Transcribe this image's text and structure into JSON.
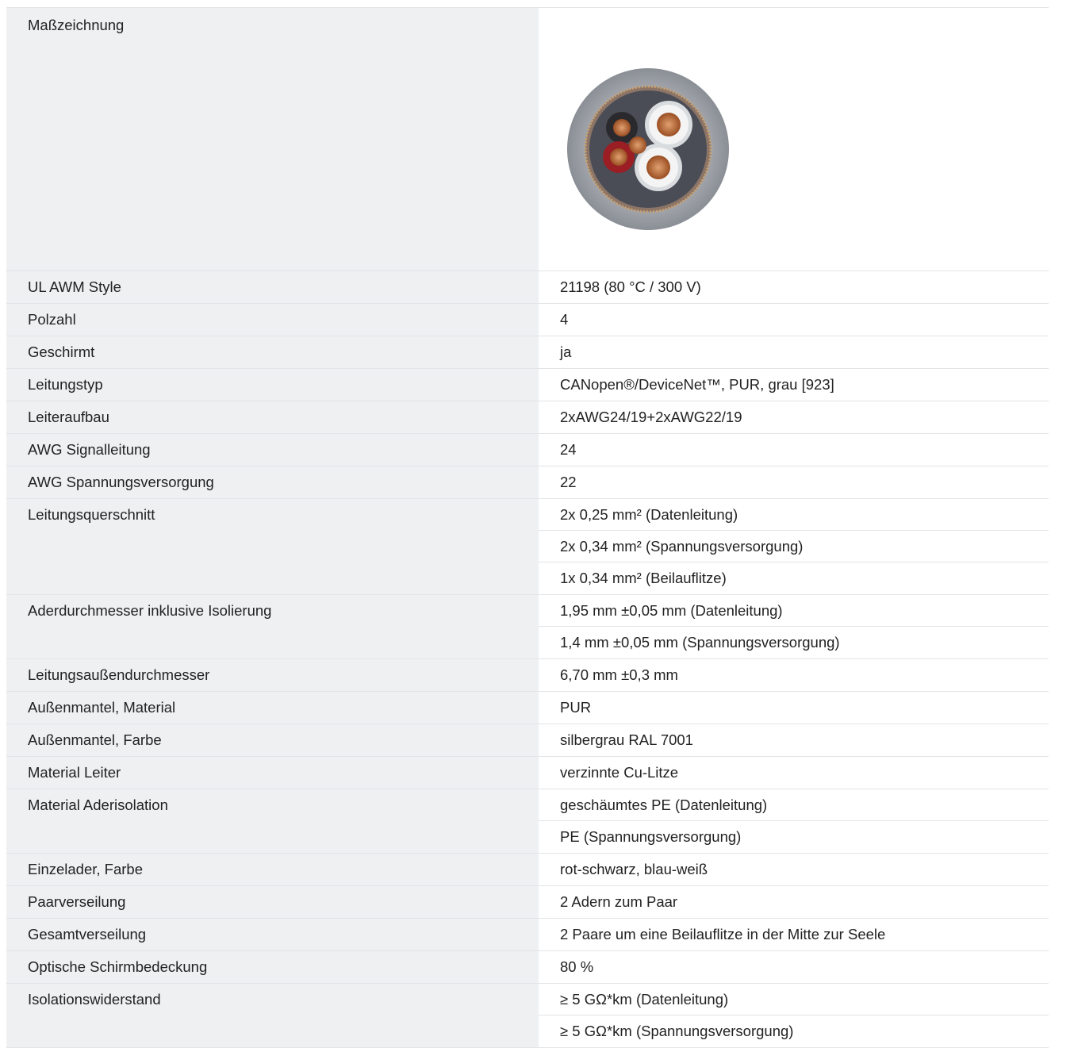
{
  "header_partial": "...open®/DeviceNet™, PUR, grau [923]",
  "drawing": {
    "label": "Maßzeichnung"
  },
  "rows": [
    {
      "label": "UL AWM Style",
      "values": [
        "21198 (80 °C / 300 V)"
      ]
    },
    {
      "label": "Polzahl",
      "values": [
        "4"
      ]
    },
    {
      "label": "Geschirmt",
      "values": [
        "ja"
      ]
    },
    {
      "label": "Leitungstyp",
      "values": [
        "CANopen®/DeviceNet™, PUR, grau [923]"
      ]
    },
    {
      "label": "Leiteraufbau",
      "values": [
        "2xAWG24/19+2xAWG22/19"
      ]
    },
    {
      "label": "AWG Signalleitung",
      "values": [
        "24"
      ]
    },
    {
      "label": "AWG Spannungsversorgung",
      "values": [
        "22"
      ]
    },
    {
      "label": "Leitungsquerschnitt",
      "values": [
        "2x 0,25 mm² (Datenleitung)",
        "2x 0,34 mm² (Spannungsversorgung)",
        "1x 0,34 mm² (Beilauflitze)"
      ]
    },
    {
      "label": "Aderdurchmesser inklusive Isolierung",
      "values": [
        "1,95 mm ±0,05 mm (Datenleitung)",
        "1,4 mm ±0,05 mm (Spannungsversorgung)"
      ]
    },
    {
      "label": "Leitungsaußendurchmesser",
      "values": [
        "6,70 mm ±0,3 mm"
      ]
    },
    {
      "label": "Außenmantel, Material",
      "values": [
        "PUR"
      ]
    },
    {
      "label": "Außenmantel, Farbe",
      "values": [
        "silbergrau RAL 7001"
      ]
    },
    {
      "label": "Material Leiter",
      "values": [
        "verzinnte Cu-Litze"
      ]
    },
    {
      "label": "Material Aderisolation",
      "values": [
        "geschäumtes PE (Datenleitung)",
        "PE (Spannungsversorgung)"
      ]
    },
    {
      "label": "Einzelader, Farbe",
      "values": [
        "rot-schwarz, blau-weiß"
      ]
    },
    {
      "label": "Paarverseilung",
      "values": [
        "2 Adern zum Paar"
      ]
    },
    {
      "label": "Gesamtverseilung",
      "values": [
        "2 Paare um eine Beilauflitze in der Mitte zur Seele"
      ]
    },
    {
      "label": "Optische Schirmbedeckung",
      "values": [
        "80 %"
      ]
    },
    {
      "label": "Isolationswiderstand",
      "values": [
        "≥ 5 GΩ*km (Datenleitung)",
        "≥ 5 GΩ*km (Spannungsversorgung)"
      ]
    }
  ]
}
